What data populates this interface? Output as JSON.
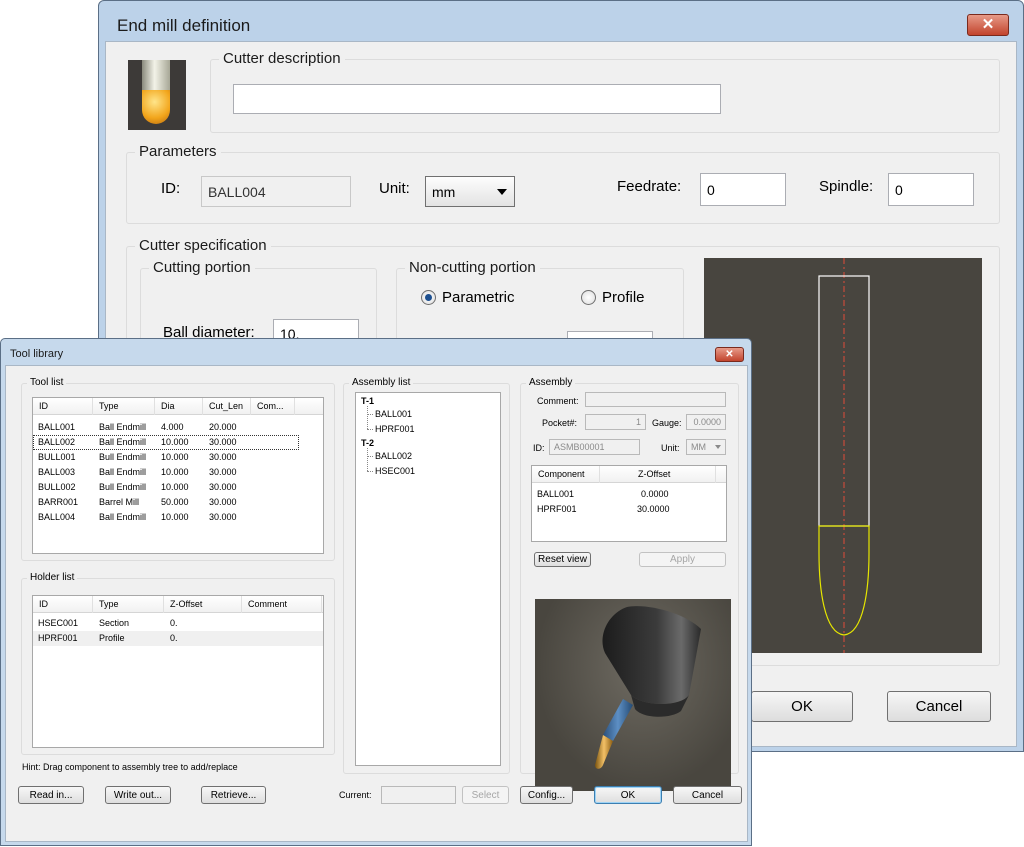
{
  "end_mill": {
    "title": "End mill definition",
    "close": "✕",
    "cutter_description": {
      "label": "Cutter description",
      "value": ""
    },
    "parameters": {
      "label": "Parameters",
      "id_label": "ID:",
      "id_value": "BALL004",
      "unit_label": "Unit:",
      "unit_value": "mm",
      "feedrate_label": "Feedrate:",
      "feedrate_value": "0",
      "spindle_label": "Spindle:",
      "spindle_value": "0"
    },
    "cutter_spec": {
      "label": "Cutter specification",
      "cutting_portion": "Cutting portion",
      "non_cutting_portion": "Non-cutting portion",
      "parametric": "Parametric",
      "profile": "Profile",
      "ball_diameter_label": "Ball diameter:",
      "ball_diameter_value": "10."
    },
    "ok": "OK",
    "cancel": "Cancel",
    "colors": {
      "preview_bg": "#48453f",
      "shank": "#ffffff",
      "cutter": "#ffff00",
      "centerline": "#ff4040"
    }
  },
  "tool_library": {
    "title": "Tool library",
    "close": "✕",
    "tool_list": {
      "label": "Tool list",
      "columns": [
        "ID",
        "Type",
        "Dia",
        "Cut_Len",
        "Com..."
      ],
      "rows": [
        [
          "BALL001",
          "Ball Endmill",
          "4.000",
          "20.000",
          ""
        ],
        [
          "BALL002",
          "Ball Endmill",
          "10.000",
          "30.000",
          ""
        ],
        [
          "BULL001",
          "Bull Endmill",
          "10.000",
          "30.000",
          ""
        ],
        [
          "BALL003",
          "Ball Endmill",
          "10.000",
          "30.000",
          ""
        ],
        [
          "BULL002",
          "Bull Endmill",
          "10.000",
          "30.000",
          ""
        ],
        [
          "BARR001",
          "Barrel Mill",
          "50.000",
          "30.000",
          ""
        ],
        [
          "BALL004",
          "Ball Endmill",
          "10.000",
          "30.000",
          ""
        ]
      ]
    },
    "holder_list": {
      "label": "Holder list",
      "columns": [
        "ID",
        "Type",
        "Z-Offset",
        "Comment"
      ],
      "rows": [
        [
          "HSEC001",
          "Section",
          "0.",
          ""
        ],
        [
          "HPRF001",
          "Profile",
          "0.",
          ""
        ]
      ]
    },
    "assembly_list": {
      "label": "Assembly list",
      "tree": [
        {
          "name": "T-1",
          "children": [
            "BALL001",
            "HPRF001"
          ]
        },
        {
          "name": "T-2",
          "children": [
            "BALL002",
            "HSEC001"
          ]
        }
      ]
    },
    "assembly": {
      "label": "Assembly",
      "comment_label": "Comment:",
      "comment_value": "",
      "pocket_label": "Pocket#:",
      "pocket_value": "1",
      "gauge_label": "Gauge:",
      "gauge_value": "0.0000",
      "id_label": "ID:",
      "id_value": "ASMB00001",
      "unit_label": "Unit:",
      "unit_value": "MM",
      "components": {
        "columns": [
          "Component",
          "Z-Offset"
        ],
        "rows": [
          [
            "BALL001",
            "0.0000"
          ],
          [
            "HPRF001",
            "30.0000"
          ]
        ]
      },
      "reset_view": "Reset view",
      "apply": "Apply"
    },
    "hint": "Hint: Drag component to assembly tree to add/replace",
    "buttons": {
      "read_in": "Read in...",
      "write_out": "Write out...",
      "retrieve": "Retrieve...",
      "current_label": "Current:",
      "current_value": "",
      "select": "Select",
      "config": "Config...",
      "ok": "OK",
      "cancel": "Cancel"
    }
  }
}
